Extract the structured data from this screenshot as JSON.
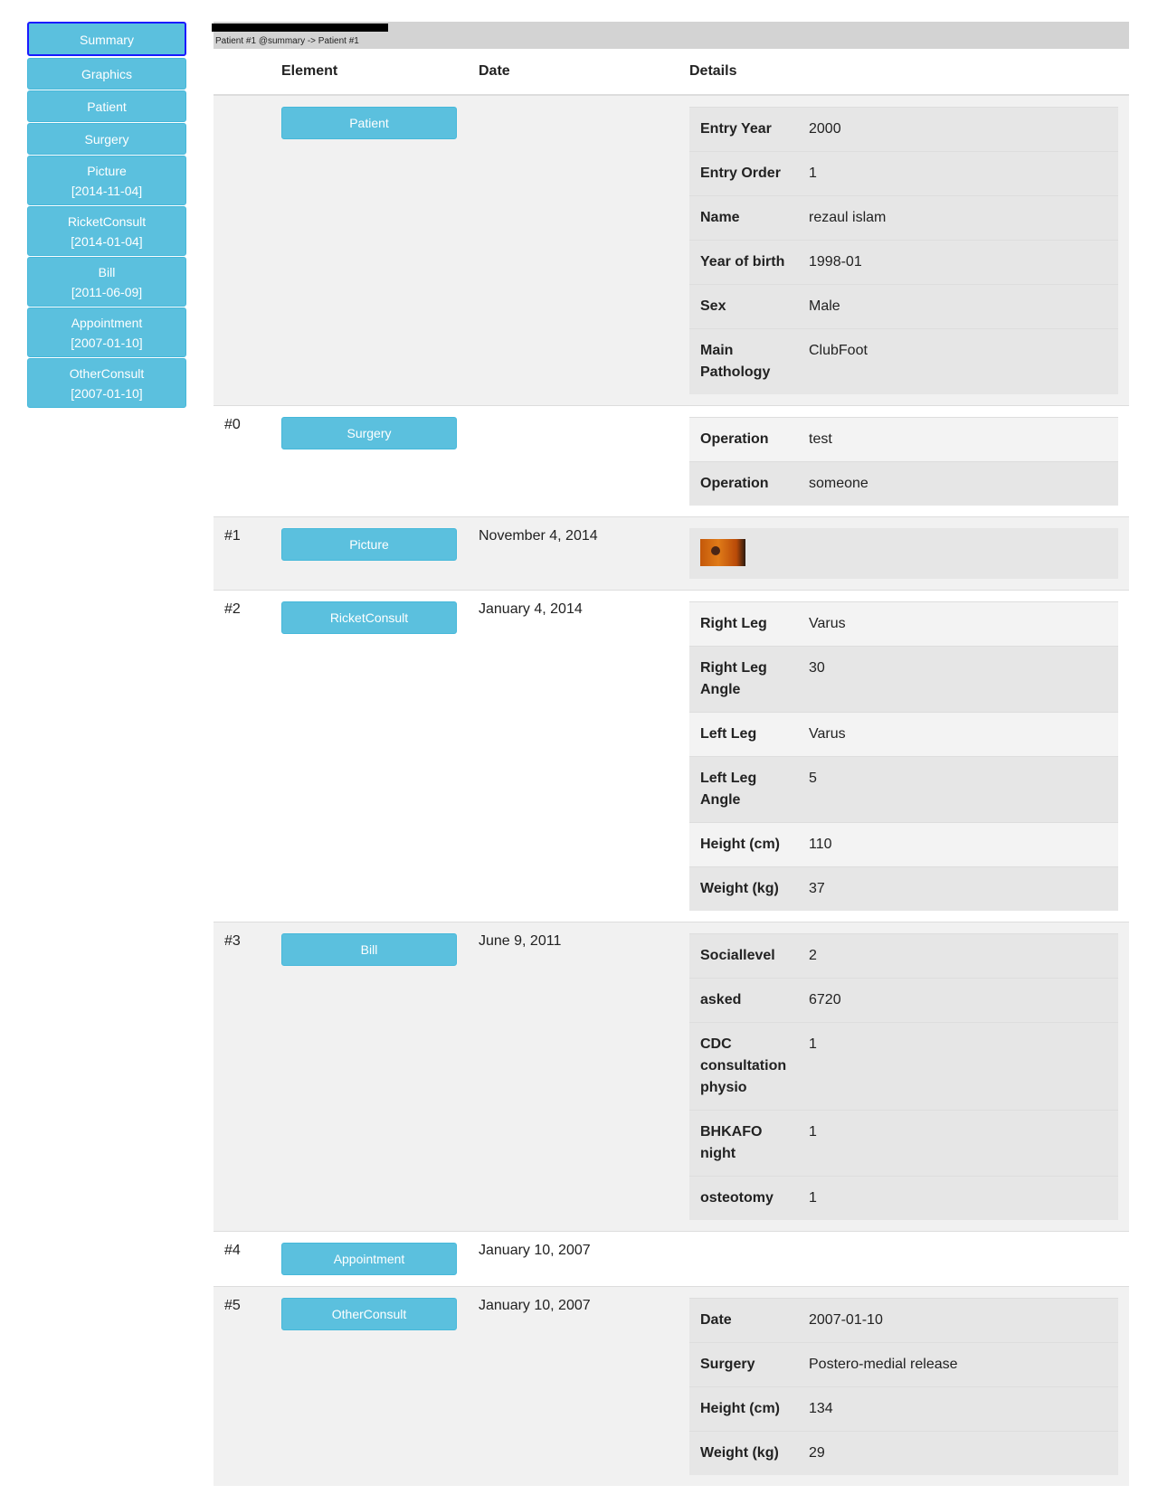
{
  "sidebar": {
    "items": [
      {
        "label": "Summary",
        "date": ""
      },
      {
        "label": "Graphics",
        "date": ""
      },
      {
        "label": "Patient",
        "date": ""
      },
      {
        "label": "Surgery",
        "date": ""
      },
      {
        "label": "Picture",
        "date": "[2014-11-04]"
      },
      {
        "label": "RicketConsult",
        "date": "[2014-01-04]"
      },
      {
        "label": "Bill",
        "date": "[2011-06-09]"
      },
      {
        "label": "Appointment",
        "date": "[2007-01-10]"
      },
      {
        "label": "OtherConsult",
        "date": "[2007-01-10]"
      }
    ]
  },
  "breadcrumb": "Patient #1 @summary -> Patient #1",
  "table": {
    "headers": {
      "index": "",
      "element": "Element",
      "date": "Date",
      "details": "Details"
    },
    "rows": [
      {
        "index": "",
        "element": "Patient",
        "date": "",
        "details": [
          {
            "key": "Entry Year",
            "value": "2000"
          },
          {
            "key": "Entry Order",
            "value": "1"
          },
          {
            "key": "Name",
            "value": "rezaul islam"
          },
          {
            "key": "Year of birth",
            "value": "1998-01"
          },
          {
            "key": "Sex",
            "value": "Male"
          },
          {
            "key": "Main Pathology",
            "value": "ClubFoot"
          }
        ]
      },
      {
        "index": "#0",
        "element": "Surgery",
        "date": "",
        "details": [
          {
            "key": "Operation",
            "value": "test"
          },
          {
            "key": "Operation",
            "value": "someone"
          }
        ]
      },
      {
        "index": "#1",
        "element": "Picture",
        "date": "November 4, 2014",
        "thumbnail": "picture-thumbnail"
      },
      {
        "index": "#2",
        "element": "RicketConsult",
        "date": "January 4, 2014",
        "details": [
          {
            "key": "Right Leg",
            "value": "Varus"
          },
          {
            "key": "Right Leg Angle",
            "value": "30"
          },
          {
            "key": "Left Leg",
            "value": "Varus"
          },
          {
            "key": "Left Leg Angle",
            "value": "5"
          },
          {
            "key": "Height (cm)",
            "value": "110"
          },
          {
            "key": "Weight (kg)",
            "value": "37"
          }
        ]
      },
      {
        "index": "#3",
        "element": "Bill",
        "date": "June 9, 2011",
        "details": [
          {
            "key": "Sociallevel",
            "value": "2"
          },
          {
            "key": "asked",
            "value": "6720"
          },
          {
            "key": "CDC consultation physio",
            "value": "1"
          },
          {
            "key": "BHKAFO night",
            "value": "1"
          },
          {
            "key": "osteotomy",
            "value": "1"
          }
        ]
      },
      {
        "index": "#4",
        "element": "Appointment",
        "date": "January 10, 2007"
      },
      {
        "index": "#5",
        "element": "OtherConsult",
        "date": "January 10, 2007",
        "details": [
          {
            "key": "Date",
            "value": "2007-01-10"
          },
          {
            "key": "Surgery",
            "value": "Postero-medial release"
          },
          {
            "key": "Height (cm)",
            "value": "134"
          },
          {
            "key": "Weight (kg)",
            "value": "29"
          }
        ]
      }
    ]
  }
}
